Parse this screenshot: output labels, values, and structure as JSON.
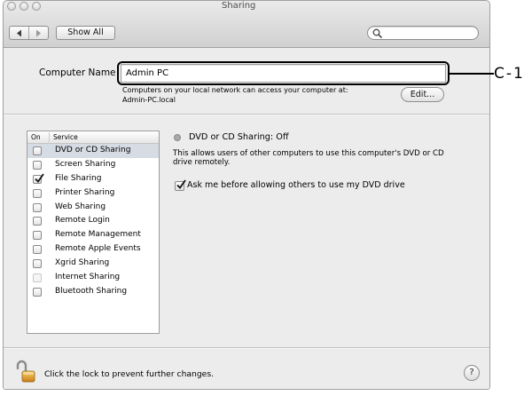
{
  "window": {
    "title": "Sharing"
  },
  "toolbar": {
    "show_all_label": "Show All"
  },
  "computer_name": {
    "label": "Computer Name",
    "value": "Admin PC",
    "info": "Computers on your local network can access your computer at:",
    "address": "Admin-PC.local",
    "edit_label": "Edit..."
  },
  "callout": {
    "label": "C-1"
  },
  "services": {
    "header_on": "On",
    "header_service": "Service",
    "selected_index": 0,
    "items": [
      {
        "name": "DVD or CD Sharing",
        "checked": false
      },
      {
        "name": "Screen Sharing",
        "checked": false
      },
      {
        "name": "File Sharing",
        "checked": true
      },
      {
        "name": "Printer Sharing",
        "checked": false
      },
      {
        "name": "Web Sharing",
        "checked": false
      },
      {
        "name": "Remote Login",
        "checked": false
      },
      {
        "name": "Remote Management",
        "checked": false
      },
      {
        "name": "Remote Apple Events",
        "checked": false
      },
      {
        "name": "Xgrid Sharing",
        "checked": false
      },
      {
        "name": "Internet Sharing",
        "checked": false,
        "disabled": true
      },
      {
        "name": "Bluetooth Sharing",
        "checked": false
      }
    ]
  },
  "detail": {
    "status": "DVD or CD Sharing: Off",
    "description": "This allows users of other computers to use this computer's DVD or CD drive remotely.",
    "ask_option": {
      "label": "Ask me before allowing others to use my DVD drive",
      "checked": true
    }
  },
  "footer": {
    "lock_message": "Click the lock to prevent further changes.",
    "help_label": "?"
  },
  "icons": {
    "back": "chevron-left-icon",
    "forward": "chevron-right-icon",
    "search": "search-icon",
    "lock": "unlocked-padlock-icon",
    "checkmark": "checkmark-icon",
    "status": "status-indicator-icon"
  },
  "colors": {
    "selected_row": "#d6dce4",
    "status_indicator": "#a9a9a9",
    "callout": "#000000"
  }
}
